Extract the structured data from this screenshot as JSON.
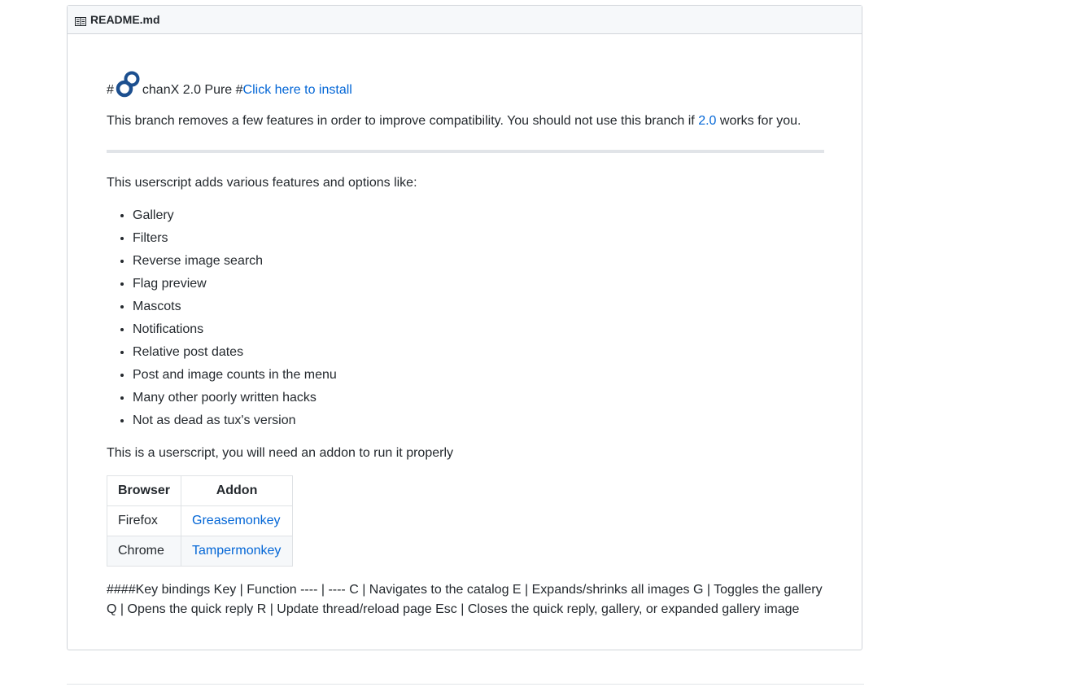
{
  "header": {
    "file_name": "README.md",
    "icon": "book-icon"
  },
  "title": {
    "hash_prefix": "#",
    "logo_icon": "chanx-logo-icon",
    "name": "chanX 2.0 Pure #",
    "install_link": "Click here to install"
  },
  "intro": {
    "text_before": "This branch removes a few features in order to improve compatibility. You should not use this branch if ",
    "link": "2.0",
    "text_after": " works for you."
  },
  "adds_text": "This userscript adds various features and options like:",
  "features": [
    "Gallery",
    "Filters",
    "Reverse image search",
    "Flag preview",
    "Mascots",
    "Notifications",
    "Relative post dates",
    "Post and image counts in the menu",
    "Many other poorly written hacks",
    "Not as dead as tux's version"
  ],
  "userscript_note": "This is a userscript, you will need an addon to run it properly",
  "addons_table": {
    "headers": [
      "Browser",
      "Addon"
    ],
    "rows": [
      {
        "browser": "Firefox",
        "addon": "Greasemonkey"
      },
      {
        "browser": "Chrome",
        "addon": "Tampermonkey"
      }
    ]
  },
  "keybindings_text": "####Key bindings Key | Function ---- | ---- C | Navigates to the catalog E | Expands/shrinks all images G | Toggles the gallery Q | Opens the quick reply R | Update thread/reload page Esc | Closes the quick reply, gallery, or expanded gallery image",
  "colors": {
    "link": "#0366d6",
    "text": "#24292e",
    "border": "#d1d5da",
    "header_bg": "#f6f8fa",
    "logo": "#1c4f8f"
  }
}
